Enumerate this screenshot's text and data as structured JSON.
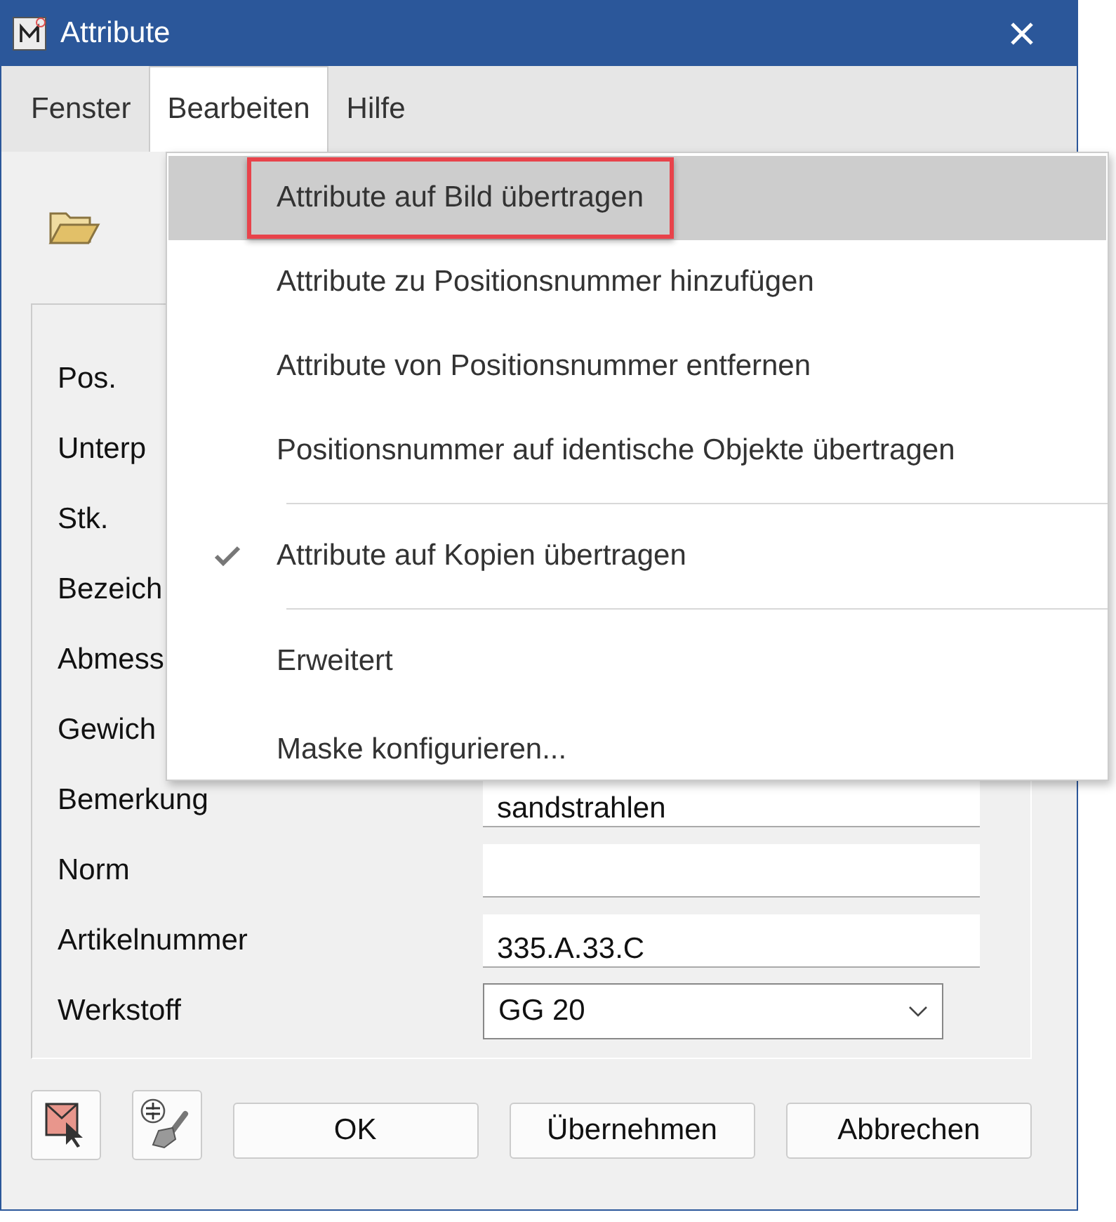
{
  "window": {
    "title": "Attribute"
  },
  "menubar": [
    {
      "label": "Fenster",
      "selected": false
    },
    {
      "label": "Bearbeiten",
      "selected": true
    },
    {
      "label": "Hilfe",
      "selected": false
    }
  ],
  "form": [
    {
      "label": "Pos.",
      "kind": "hidden"
    },
    {
      "label": "Unterp",
      "kind": "hidden"
    },
    {
      "label": "Stk.",
      "kind": "hidden"
    },
    {
      "label": "Bezeich",
      "kind": "hidden"
    },
    {
      "label": "Abmess",
      "kind": "hidden"
    },
    {
      "label": "Gewich",
      "kind": "hidden"
    },
    {
      "label": "Bemerkung",
      "kind": "text",
      "value": "sandstrahlen"
    },
    {
      "label": "Norm",
      "kind": "text"
    },
    {
      "label": "Artikelnummer",
      "kind": "text",
      "value": "335.A.33.C"
    },
    {
      "label": "Werkstoff",
      "kind": "combo",
      "value": "GG 20"
    }
  ],
  "buttons": [
    "OK",
    "Übernehmen",
    "Abbrechen"
  ],
  "menu": [
    {
      "kind": "item",
      "label": "Attribute auf Bild übertragen",
      "selected": true,
      "checked": false,
      "outlined": true
    },
    {
      "kind": "item",
      "label": "Attribute zu Positionsnummer hinzufügen",
      "selected": false,
      "checked": false,
      "outlined": false
    },
    {
      "kind": "item",
      "label": "Attribute von Positionsnummer entfernen",
      "selected": false,
      "checked": false,
      "outlined": false
    },
    {
      "kind": "item",
      "label": "Positionsnummer auf identische Objekte übertragen",
      "selected": false,
      "checked": false,
      "outlined": false
    },
    {
      "kind": "separator"
    },
    {
      "kind": "item",
      "label": "Attribute auf Kopien übertragen",
      "selected": false,
      "checked": true,
      "outlined": false
    },
    {
      "kind": "separator"
    },
    {
      "kind": "item",
      "label": "Erweitert",
      "selected": false,
      "checked": false,
      "outlined": false
    },
    {
      "kind": "item",
      "label": "Maske konfigurieren...",
      "selected": false,
      "checked": false,
      "outlined": false
    }
  ]
}
